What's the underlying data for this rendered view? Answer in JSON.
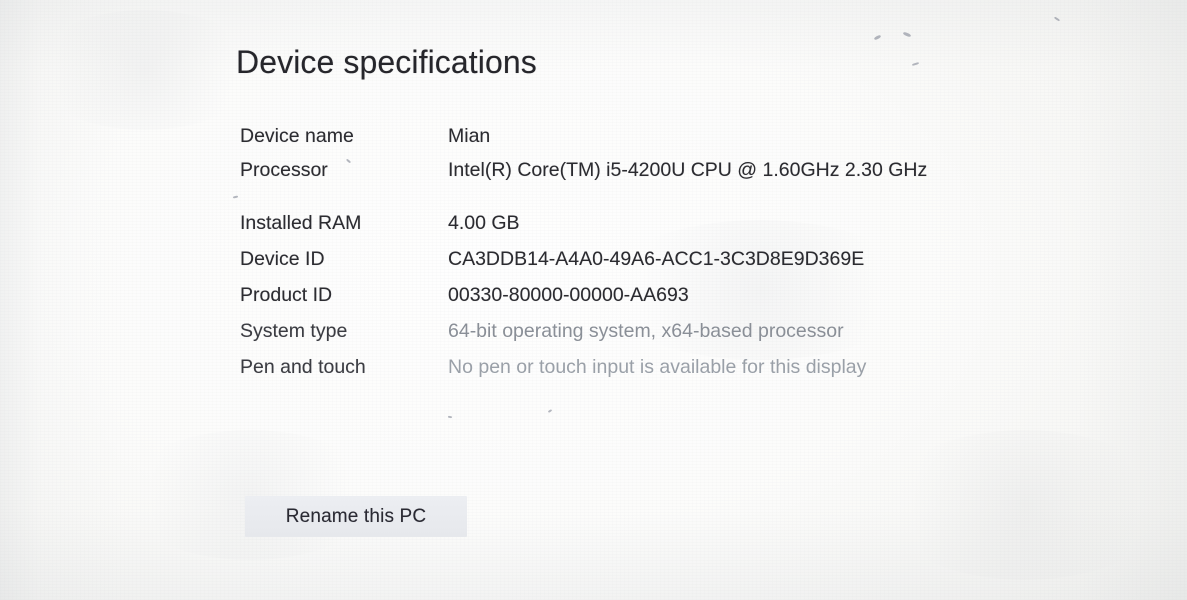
{
  "page": {
    "heading": "Device specifications"
  },
  "specs": [
    {
      "label": "Device name",
      "value": "Mian"
    },
    {
      "label": "Processor",
      "value": "Intel(R) Core(TM) i5-4200U CPU @ 1.60GHz   2.30 GHz"
    },
    {
      "label": "Installed RAM",
      "value": "4.00 GB"
    },
    {
      "label": "Device ID",
      "value": "CA3DDB14-A4A0-49A6-ACC1-3C3D8E9D369E"
    },
    {
      "label": "Product ID",
      "value": "00330-80000-00000-AA693"
    },
    {
      "label": "System type",
      "value": "64-bit operating system, x64-based processor"
    },
    {
      "label": "Pen and touch",
      "value": "No pen or touch input is available for this display"
    }
  ],
  "actions": {
    "rename_pc": "Rename this PC"
  },
  "colors": {
    "page_background": "#fbfbfa",
    "heading_text": "#26262b",
    "label_text": "#2c2c31",
    "value_text": "#2b2b30",
    "faded_value_text": "#8a8f97",
    "button_background": "#eaecf0",
    "button_text": "#2a2a33"
  }
}
